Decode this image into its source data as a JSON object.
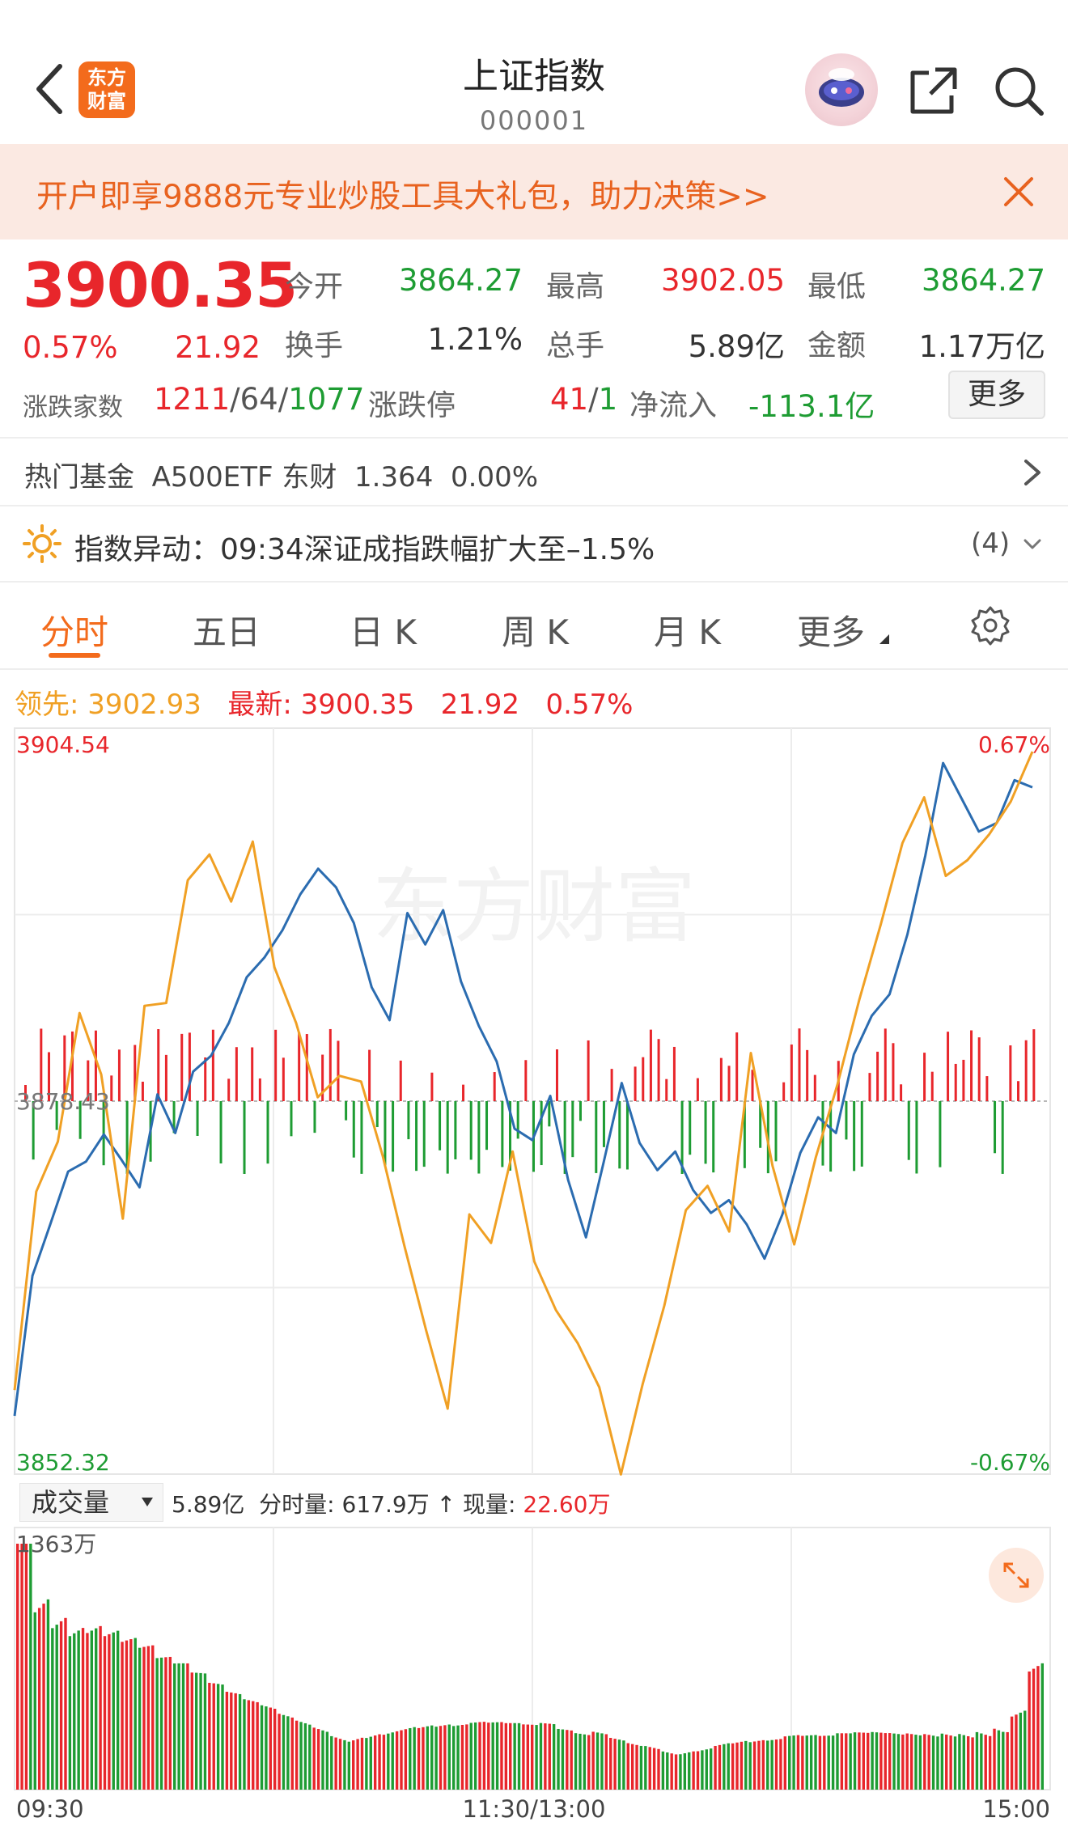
{
  "header": {
    "title": "上证指数",
    "code": "000001",
    "logo_text_line1": "东方",
    "logo_text_line2": "财富"
  },
  "banner": {
    "text": "开户即享9888元专业炒股工具大礼包，助力决策>>"
  },
  "quote": {
    "price": "3900.35",
    "change_pct": "0.57%",
    "change": "21.92",
    "open_label": "今开",
    "open": "3864.27",
    "high_label": "最高",
    "high": "3902.05",
    "low_label": "最低",
    "low": "3864.27",
    "turnover_label": "换手",
    "turnover": "1.21%",
    "volume_label": "总手",
    "volume": "5.89亿",
    "amount_label": "金额",
    "amount": "1.17万亿",
    "breadth_label": "涨跌家数",
    "up": "1211",
    "flat": "64",
    "down": "1077",
    "sep": "/",
    "limit_label": "涨跌停",
    "limit_up": "41",
    "limit_down": "1",
    "inflow_label": "净流入",
    "inflow": "-113.1亿",
    "more_label": "更多"
  },
  "fund_row": {
    "label": "热门基金",
    "name": "A500ETF 东财",
    "price": "1.364",
    "pct": "0.00%"
  },
  "alert": {
    "label": "指数异动：",
    "text": "09:34深证成指跌幅扩大至–1.5%",
    "count": "(4)"
  },
  "tabs": [
    {
      "label": "分时"
    },
    {
      "label": "五日"
    },
    {
      "label": "日 K"
    },
    {
      "label": "周 K"
    },
    {
      "label": "月 K"
    },
    {
      "label": "更多"
    }
  ],
  "legend": {
    "leader_label": "领先:",
    "leader_value": "3902.93",
    "latest_label": "最新:",
    "latest_value": "3900.35",
    "latest_change": "21.92",
    "latest_pct": "0.57%"
  },
  "colors": {
    "up": "#e8262b",
    "down": "#1e9c33",
    "price_line": "#2b6cb0",
    "leader_line": "#f0a024",
    "accent": "#f36b1c"
  },
  "volume_panel": {
    "select_label": "成交量",
    "total": "5.89亿",
    "minute_label": "分时量:",
    "minute_value": "617.9万",
    "current_label": "现量:",
    "current_value": "22.60万"
  },
  "chart_data": {
    "type": "line",
    "ylim": [
      3852.32,
      3904.54
    ],
    "prev_close": "3878.43",
    "y_top_label": "3904.54",
    "y_mid_label": "3878.43",
    "y_bottom_label": "3852.32",
    "pct_top_label": "0.67%",
    "pct_bottom_label": "-0.67%",
    "x_ticks": [
      "09:30",
      "11:30/13:00",
      "15:00"
    ],
    "vol_max_label": "1363万",
    "watermark": "东方财富",
    "series": [
      {
        "name": "最新",
        "values": [
          3856.4,
          3866.2,
          3869.8,
          3873.5,
          3874.2,
          3876.1,
          3874.3,
          3872.4,
          3878.9,
          3876.2,
          3880.5,
          3881.6,
          3883.9,
          3887.1,
          3888.5,
          3890.4,
          3892.9,
          3894.7,
          3893.4,
          3890.9,
          3886.4,
          3884.1,
          3891.6,
          3889.4,
          3891.8,
          3886.8,
          3883.7,
          3881.2,
          3876.5,
          3875.7,
          3878.8,
          3872.9,
          3868.9,
          3874.2,
          3879.7,
          3875.5,
          3873.6,
          3874.9,
          3872.2,
          3870.6,
          3871.5,
          3869.8,
          3867.4,
          3870.5,
          3874.8,
          3877.3,
          3876.2,
          3881.7,
          3884.4,
          3885.9,
          3890.1,
          3895.6,
          3902.1,
          3899.7,
          3897.3,
          3897.9,
          3900.9,
          3900.4
        ]
      },
      {
        "name": "领先",
        "values": [
          3858.2,
          3872.1,
          3875.6,
          3884.6,
          3880.3,
          3870.2,
          3885.1,
          3885.3,
          3893.9,
          3895.7,
          3892.4,
          3896.6,
          3887.8,
          3883.9,
          3878.7,
          3880.2,
          3879.8,
          3874.6,
          3868.3,
          3862.4,
          3856.9,
          3870.5,
          3868.5,
          3874.9,
          3867.2,
          3863.8,
          3861.5,
          3858.4,
          3852.3,
          3858.6,
          3864.1,
          3870.8,
          3872.5,
          3869.3,
          3881.8,
          3873.9,
          3868.4,
          3874.5,
          3879.6,
          3885.5,
          3890.8,
          3896.5,
          3899.7,
          3894.2,
          3895.3,
          3897.1,
          3899.4,
          3902.9
        ]
      }
    ],
    "volume_label": "成交量",
    "volume_values": [
      1363,
      1180,
      980,
      860,
      820,
      760,
      700,
      650,
      590,
      560,
      520,
      480,
      450,
      430,
      420,
      400,
      390,
      380,
      360,
      350,
      340,
      330,
      330,
      320,
      310,
      300,
      305,
      300,
      295,
      290,
      300,
      280,
      270,
      290,
      275,
      265,
      270,
      260,
      255,
      250,
      260,
      255,
      245,
      240,
      250,
      245,
      240,
      250,
      255,
      260,
      262,
      270,
      280,
      300,
      320,
      360,
      420,
      520,
      760
    ]
  }
}
